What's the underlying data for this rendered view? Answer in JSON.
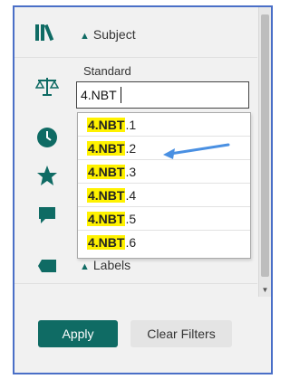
{
  "filters": {
    "subject_label": "Subject",
    "standard_label": "Standard",
    "standard_input_value": "4.NBT",
    "labels_label": "Labels"
  },
  "dropdown": {
    "options": [
      {
        "match": "4.NBT",
        "rest": ".1"
      },
      {
        "match": "4.NBT",
        "rest": ".2"
      },
      {
        "match": "4.NBT",
        "rest": ".3"
      },
      {
        "match": "4.NBT",
        "rest": ".4"
      },
      {
        "match": "4.NBT",
        "rest": ".5"
      },
      {
        "match": "4.NBT",
        "rest": ".6"
      }
    ]
  },
  "buttons": {
    "apply": "Apply",
    "clear": "Clear Filters"
  },
  "icons": {
    "subject": "books-icon",
    "standard": "scale-icon",
    "time": "clock-icon",
    "favorite": "star-icon",
    "comment": "comment-icon",
    "labels": "tag-icon"
  },
  "colors": {
    "accent": "#0f6b64",
    "highlight": "#fff200",
    "frame": "#4a6fc7",
    "arrow": "#4a90e2"
  }
}
